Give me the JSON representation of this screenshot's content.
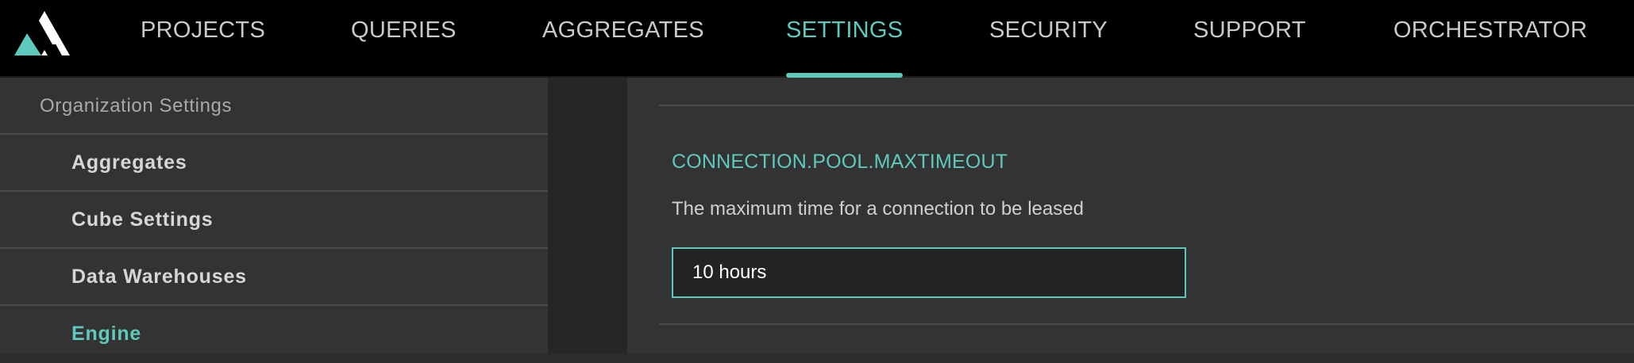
{
  "nav": {
    "logo_name": "atscale-logo",
    "items": [
      {
        "label": "PROJECTS",
        "active": false
      },
      {
        "label": "QUERIES",
        "active": false
      },
      {
        "label": "AGGREGATES",
        "active": false
      },
      {
        "label": "SETTINGS",
        "active": true
      },
      {
        "label": "SECURITY",
        "active": false
      },
      {
        "label": "SUPPORT",
        "active": false
      },
      {
        "label": "ORCHESTRATOR",
        "active": false
      }
    ]
  },
  "sidebar": {
    "header": "Organization Settings",
    "items": [
      {
        "label": "Aggregates",
        "active": false
      },
      {
        "label": "Cube Settings",
        "active": false
      },
      {
        "label": "Data Warehouses",
        "active": false
      },
      {
        "label": "Engine",
        "active": true
      }
    ]
  },
  "setting": {
    "key": "CONNECTION.POOL.MAXTIMEOUT",
    "description": "The maximum time for a connection to be leased",
    "value": "10 hours"
  },
  "colors": {
    "accent": "#5ec9bd",
    "nav_bg": "#000000",
    "panel_bg": "#333333"
  }
}
